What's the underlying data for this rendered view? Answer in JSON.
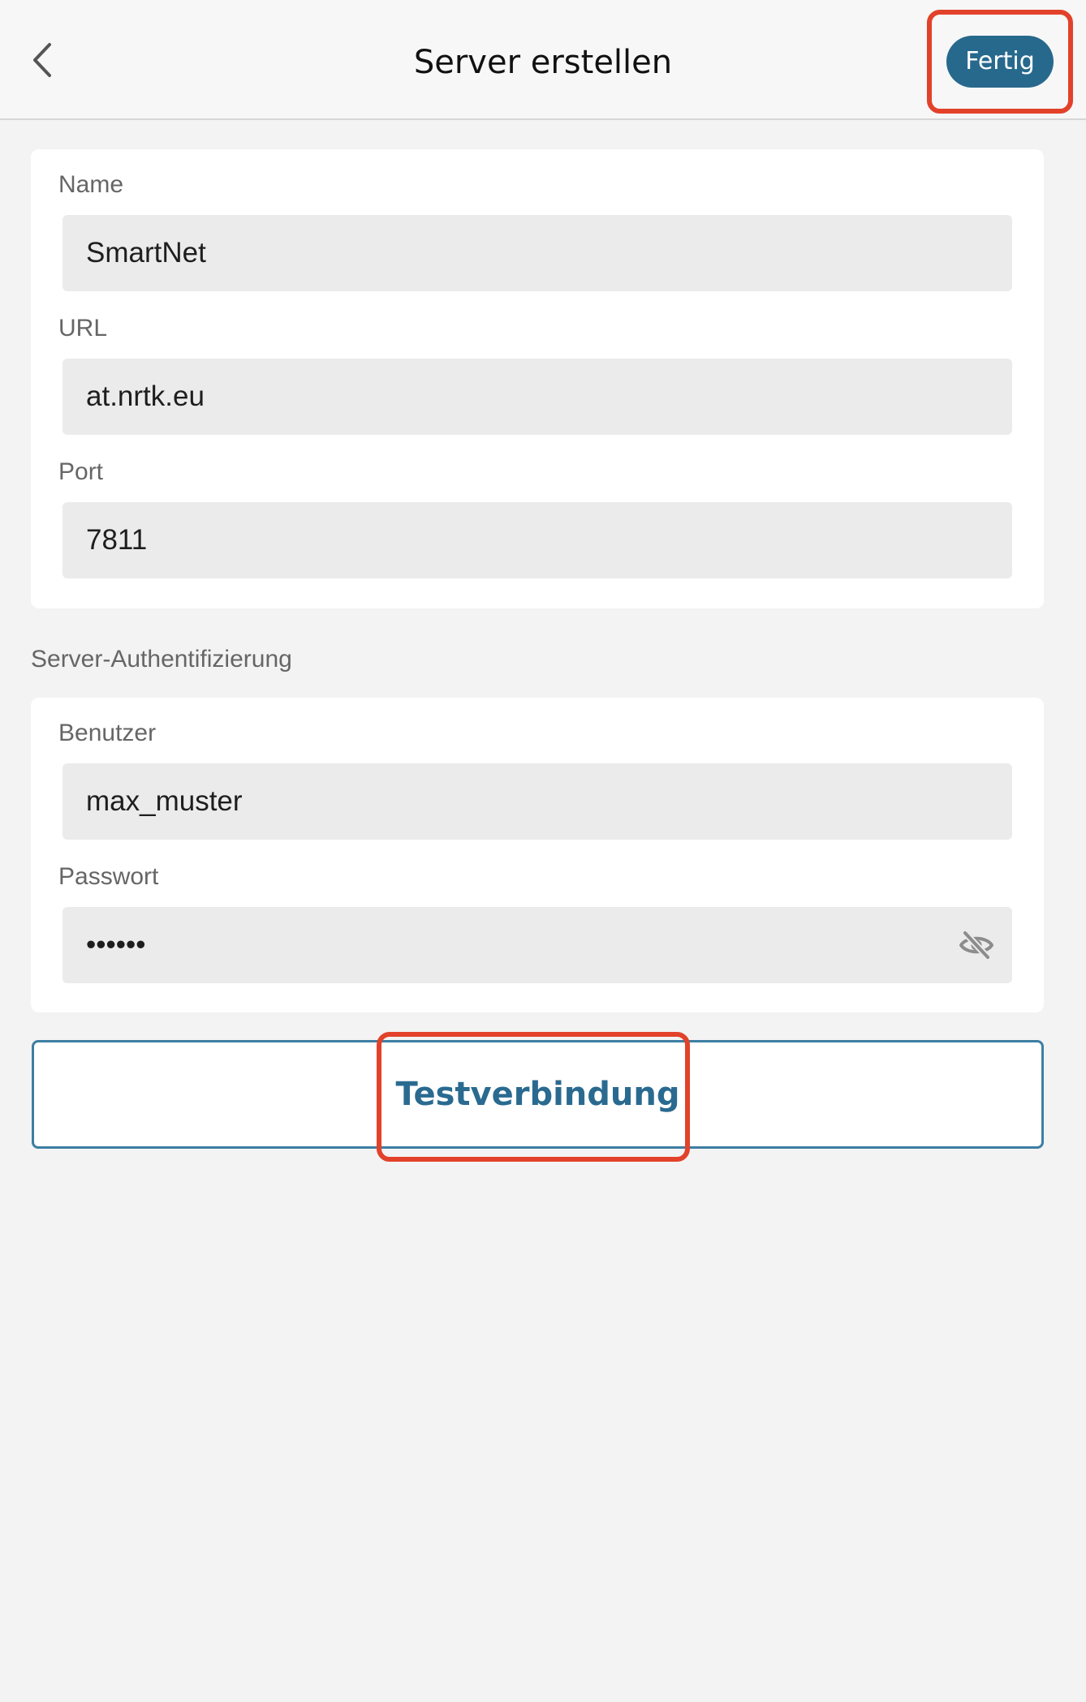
{
  "header": {
    "title": "Server erstellen",
    "back_icon": "chevron-left-icon",
    "done_label": "Fertig"
  },
  "server": {
    "name_label": "Name",
    "name_value": "SmartNet",
    "url_label": "URL",
    "url_value": "at.nrtk.eu",
    "port_label": "Port",
    "port_value": "7811"
  },
  "auth": {
    "section_title": "Server-Authentifizierung",
    "user_label": "Benutzer",
    "user_value": "max_muster",
    "password_label": "Passwort",
    "password_value": "••••••",
    "visibility_icon": "eye-off-icon"
  },
  "test_button_label": "Testverbindung",
  "colors": {
    "accent": "#27698d",
    "highlight": "#e2422a",
    "background": "#f3f3f3",
    "field_background": "#ebebeb"
  }
}
